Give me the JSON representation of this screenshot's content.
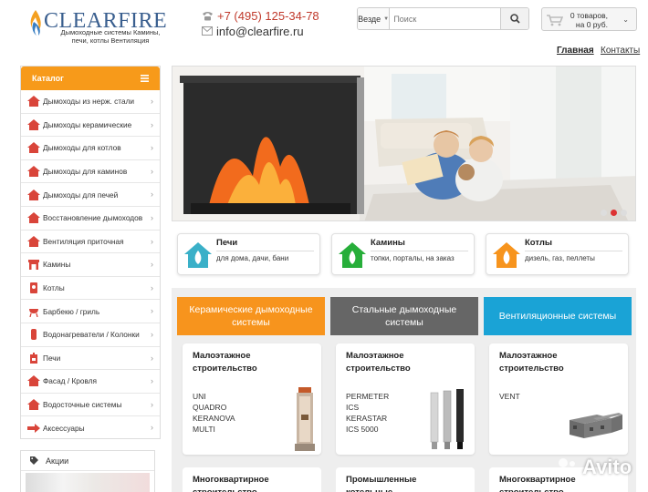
{
  "header": {
    "logo_name": "CLEARFIRE",
    "logo_tagline": "Дымоходные системы Камины, печи, котлы Вентиляция",
    "phone": "+7 (495) 125-34-78",
    "email": "info@clearfire.ru"
  },
  "search": {
    "scope": "Везде",
    "placeholder": "Поиск"
  },
  "cart": {
    "line1": "0 товаров,",
    "line2": "на 0 руб."
  },
  "nav": {
    "home": "Главная",
    "contacts": "Контакты"
  },
  "sidebar": {
    "title": "Каталог",
    "items": [
      {
        "label": "Дымоходы из нерж. стали",
        "icon": "house-icon"
      },
      {
        "label": "Дымоходы керамические",
        "icon": "house-icon"
      },
      {
        "label": "Дымоходы для котлов",
        "icon": "house-icon"
      },
      {
        "label": "Дымоходы для каминов",
        "icon": "house-icon"
      },
      {
        "label": "Дымоходы для печей",
        "icon": "house-icon"
      },
      {
        "label": "Восстановление дымоходов",
        "icon": "house-icon"
      },
      {
        "label": "Вентиляция приточная",
        "icon": "house-icon"
      },
      {
        "label": "Камины",
        "icon": "fireplace-icon"
      },
      {
        "label": "Котлы",
        "icon": "boiler-icon"
      },
      {
        "label": "Барбекю / гриль",
        "icon": "grill-icon"
      },
      {
        "label": "Водонагреватели / Колонки",
        "icon": "heater-icon"
      },
      {
        "label": "Печи",
        "icon": "stove-icon"
      },
      {
        "label": "Фасад / Кровля",
        "icon": "house-icon"
      },
      {
        "label": "Водосточные системы",
        "icon": "house-icon"
      },
      {
        "label": "Аксессуары",
        "icon": "arrow-icon"
      }
    ]
  },
  "promo": {
    "title": "Акции"
  },
  "features": [
    {
      "title": "Печи",
      "subtitle": "для дома, дачи, бани",
      "color": "#3ab0c8"
    },
    {
      "title": "Камины",
      "subtitle": "топки, порталы, на заказ",
      "color": "#27ae3a"
    },
    {
      "title": "Котлы",
      "subtitle": "дизель, газ, пеллеты",
      "color": "#f7941d"
    }
  ],
  "columns": [
    {
      "title": "Керамические дымоходные системы",
      "color": "#f7941d",
      "card_title": "Малоэтажное строительство",
      "lines": [
        "UNI",
        "QUADRO",
        "KERANOVA",
        "MULTI"
      ],
      "card2_title": "Многоквартирное строительство"
    },
    {
      "title": "Стальные дымоходные системы",
      "color": "#666666",
      "card_title": "Малоэтажное строительство",
      "lines": [
        "PERMETER",
        "ICS",
        "KERASTAR",
        "ICS 5000"
      ],
      "card2_title": "Промышленные котельные"
    },
    {
      "title": "Вентиляционные системы",
      "color": "#1aa3d6",
      "card_title": "Малоэтажное строительство",
      "lines": [
        "VENT"
      ],
      "card2_title": "Многоквартирное строительство"
    }
  ],
  "watermark": "Avito",
  "colors": {
    "accent": "#f79a1a",
    "phone": "#c0392b",
    "logo": "#3a5f8f"
  }
}
